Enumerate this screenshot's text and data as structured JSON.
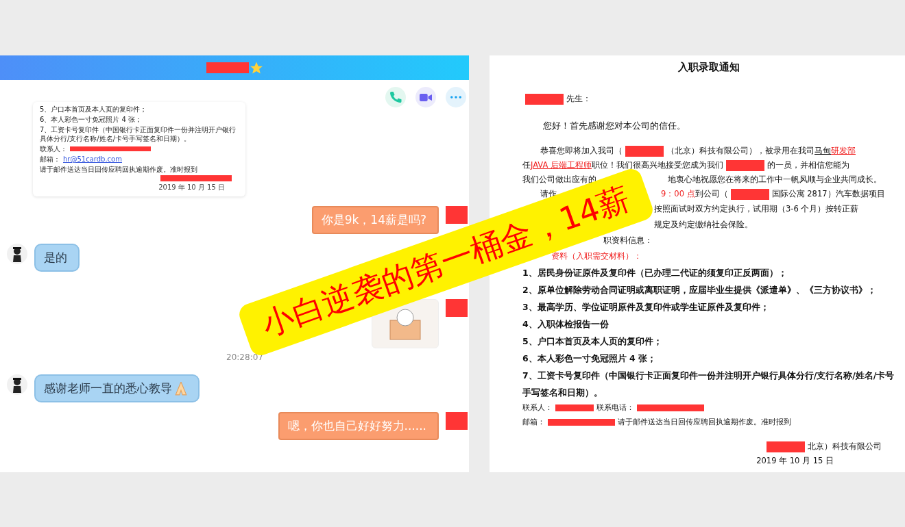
{
  "banner": {
    "text": "小白逆袭的第一桶金，14薪"
  },
  "chat": {
    "header": {
      "badge": true
    },
    "actions": [
      {
        "kind": "phone"
      },
      {
        "kind": "video"
      },
      {
        "kind": "more"
      }
    ],
    "messages": [
      {
        "kind": "document",
        "lines": [
          "5、户口本首页及本人页的复印件；",
          "6、本人彩色一寸免冠照片 4 张；",
          "7、工资卡号复印件（中国银行卡正面复印件一份并注明开户银行具体分行/支行名称/姓名/卡号手写签名和日期）。"
        ],
        "contact_label": "联系人：",
        "email_label": "邮箱：",
        "email": "hr@51cardb.com",
        "email_note": "请于邮件送达当日回传应聘回执逾期作废。准时报到",
        "date": "2019 年 10 月 15 日"
      },
      {
        "kind": "outgoing",
        "text": "你是9k，14薪是吗?",
        "emoji": false
      },
      {
        "kind": "incoming",
        "text": "是的",
        "emoji": false
      },
      {
        "kind": "sticker"
      },
      {
        "kind": "time",
        "text": "20:28:07"
      },
      {
        "kind": "incoming",
        "text": "感谢老师一直的悉心教导",
        "emoji": true
      },
      {
        "kind": "outgoing",
        "text": "嗯，你也自己好好努力......",
        "emoji": false
      }
    ]
  },
  "document": {
    "title": "入职录取通知",
    "lines": [
      {
        "kind": "salutation",
        "segments": [
          {
            "kind": "redact"
          },
          {
            "kind": "text",
            "text": "先生："
          }
        ]
      },
      {
        "kind": "greeting",
        "segments": [
          {
            "kind": "text",
            "text": "您好！首先感谢您对本公司的信任。"
          }
        ]
      },
      {
        "kind": "para",
        "segments": [
          {
            "kind": "text",
            "text": "恭喜您即将加入我司（"
          },
          {
            "kind": "redact"
          },
          {
            "kind": "text",
            "text": "（北京）科技有限公司），被录用在我司"
          },
          {
            "kind": "underline",
            "text": "马甸"
          },
          {
            "kind": "red_underline",
            "text": "研发部"
          }
        ]
      },
      {
        "kind": "plain",
        "segments": [
          {
            "kind": "text",
            "text": "任 "
          },
          {
            "kind": "red_underline",
            "text": "JAVA 后端工程师"
          },
          {
            "kind": "text",
            "text": "职位！我们很高兴地接受您成为我们"
          },
          {
            "kind": "redact"
          },
          {
            "kind": "text",
            "text": "的一员，并相信您能为"
          }
        ]
      },
      {
        "kind": "plain",
        "segments": [
          {
            "kind": "text",
            "text": "我们公司做出应有的"
          },
          {
            "kind": "after_gap",
            "text": "地衷心地祝愿您在将来的工作中一帆风顺与企业共同成长。"
          }
        ]
      },
      {
        "kind": "para",
        "segments": [
          {
            "kind": "text",
            "text": "请作"
          },
          {
            "kind": "red_after_gap",
            "text": "9：00 点"
          },
          {
            "kind": "text",
            "text": "到公司（"
          },
          {
            "kind": "redact"
          },
          {
            "kind": "text",
            "text": "国际公寓 2817）汽车数据项目"
          }
        ]
      },
      {
        "kind": "tail",
        "segments": [
          {
            "kind": "text",
            "text": "按照面试时双方约定执行，试用期（3-6 个月）按转正薪"
          }
        ]
      },
      {
        "kind": "tail",
        "segments": [
          {
            "kind": "text",
            "text": "规定及约定缴纳社会保险。"
          }
        ]
      },
      {
        "kind": "tail_mid",
        "segments": [
          {
            "kind": "text",
            "text": "职资料信息："
          }
        ]
      },
      {
        "kind": "tail_short",
        "segments": [
          {
            "kind": "red",
            "text": "资料（入职需交材料）："
          }
        ]
      },
      {
        "kind": "item",
        "segments": [
          {
            "kind": "text",
            "text": "1、居民身份证原件及复印件（已办理二代证的须复印正反两面）；"
          }
        ]
      },
      {
        "kind": "item",
        "segments": [
          {
            "kind": "text",
            "text": "2、原单位解除劳动合同证明或离职证明，应届毕业生提供《派遣单》、《三方协议书》；"
          }
        ]
      },
      {
        "kind": "item",
        "segments": [
          {
            "kind": "text",
            "text": "3、最高学历、学位证明原件及复印件或学生证原件及复印件；"
          }
        ]
      },
      {
        "kind": "item",
        "segments": [
          {
            "kind": "text",
            "text": "4、入职体检报告一份"
          }
        ]
      },
      {
        "kind": "item",
        "segments": [
          {
            "kind": "text",
            "text": "5、户口本首页及本人页的复印件；"
          }
        ]
      },
      {
        "kind": "item",
        "segments": [
          {
            "kind": "text",
            "text": "6、本人彩色一寸免冠照片 4 张；"
          }
        ]
      },
      {
        "kind": "item",
        "segments": [
          {
            "kind": "text",
            "text": "7、工资卡号复印件（中国银行卡正面复印件一份并注明开户银行具体分行/支行名称/姓名/卡号手写签名和日期）。"
          }
        ]
      },
      {
        "kind": "small",
        "segments": [
          {
            "kind": "text",
            "text": "联系人："
          },
          {
            "kind": "redact"
          },
          {
            "kind": "text",
            "text": "联系电话："
          },
          {
            "kind": "redact_long"
          }
        ]
      },
      {
        "kind": "small",
        "segments": [
          {
            "kind": "text",
            "text": "邮箱："
          },
          {
            "kind": "redact_long"
          },
          {
            "kind": "text",
            "text": "请于邮件送达当日回传应聘回执逾期作废。准时报到"
          }
        ]
      },
      {
        "kind": "sign",
        "segments": [
          {
            "kind": "redact"
          },
          {
            "kind": "text",
            "text": "北京）科技有限公司"
          }
        ]
      },
      {
        "kind": "date",
        "segments": [
          {
            "kind": "text",
            "text": "2019 年 10 月 15 日"
          }
        ]
      }
    ]
  }
}
